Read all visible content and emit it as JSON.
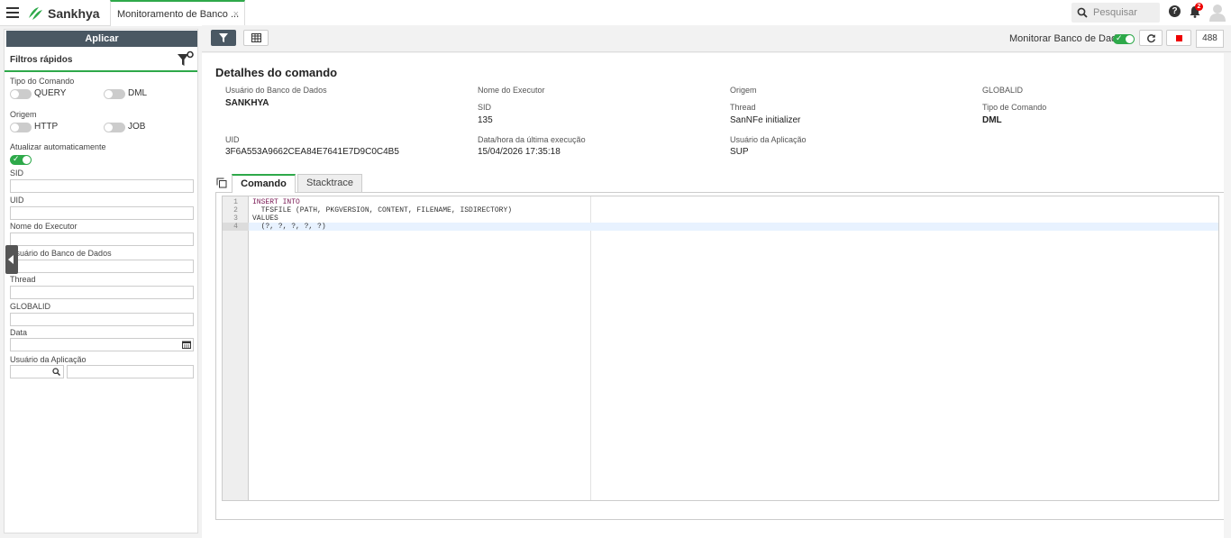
{
  "header": {
    "brand": "Sankhya",
    "active_tab": "Monitoramento de Banco ...",
    "tab_close": "×",
    "search_placeholder": "Pesquisar",
    "help": "?",
    "notification_count": "2"
  },
  "sidebar": {
    "apply_label": "Aplicar",
    "quick_filters_title": "Filtros rápidos",
    "command_type_label": "Tipo do Comando",
    "query_label": "QUERY",
    "dml_label": "DML",
    "origin_label": "Origem",
    "http_label": "HTTP",
    "job_label": "JOB",
    "auto_refresh_label": "Atualizar automaticamente",
    "auto_refresh_on": true,
    "sid_label": "SID",
    "uid_label": "UID",
    "executor_label": "Nome do Executor",
    "db_user_label": "Usuário do Banco de Dados",
    "thread_label": "Thread",
    "globalid_label": "GLOBALID",
    "date_label": "Data",
    "app_user_label": "Usuário da Aplicação"
  },
  "toolbar": {
    "monitor_label": "Monitorar Banco de Dados",
    "monitor_on": true,
    "count": "488"
  },
  "details": {
    "title": "Detalhes do comando",
    "db_user_label": "Usuário do Banco de Dados",
    "db_user_value": "SANKHYA",
    "executor_label": "Nome do Executor",
    "origin_label": "Origem",
    "globalid_label": "GLOBALID",
    "sid_label": "SID",
    "sid_value": "135",
    "thread_label": "Thread",
    "thread_value": "SanNFe initializer",
    "command_type_label": "Tipo de Comando",
    "command_type_value": "DML",
    "uid_label": "UID",
    "uid_value": "3F6A553A9662CEA84E7641E7D9C0C4B5",
    "last_exec_label": "Data/hora da última execução",
    "last_exec_value": "15/04/2026 17:35:18",
    "app_user_label": "Usuário da Aplicação",
    "app_user_value": "SUP"
  },
  "tabs": {
    "command": "Comando",
    "stacktrace": "Stacktrace"
  },
  "editor": {
    "lines": [
      {
        "n": "1",
        "kw": "INSERT INTO",
        "text": ""
      },
      {
        "n": "2",
        "kw": "",
        "text": "  TFSFILE (PATH, PKGVERSION, CONTENT, FILENAME, ISDIRECTORY)"
      },
      {
        "n": "3",
        "kw": "",
        "text": "VALUES"
      },
      {
        "n": "4",
        "kw": "",
        "text": "  (?, ?, ?, ?, ?)"
      }
    ]
  },
  "colors": {
    "accent": "#2ea94a",
    "dark_button": "#4a5863",
    "stop": "#e00000"
  },
  "icons": [
    "menu-icon",
    "sankhya-logo-icon",
    "close-icon",
    "search-icon",
    "help-icon",
    "bell-icon",
    "user-avatar-icon",
    "filter-settings-icon",
    "calendar-icon",
    "search-lookup-icon",
    "filter-icon",
    "grid-icon",
    "refresh-icon",
    "stop-icon",
    "copy-icon",
    "chevron-left-icon"
  ]
}
